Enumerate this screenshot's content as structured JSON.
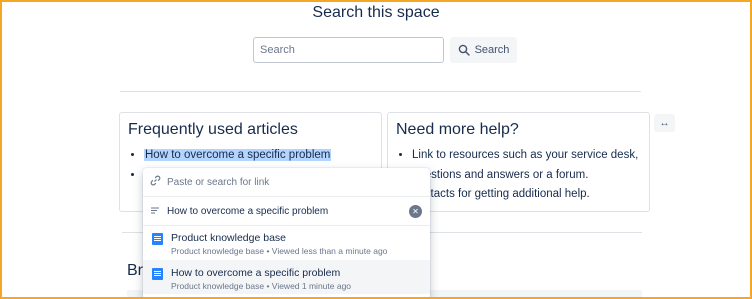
{
  "page": {
    "title": "Search this space"
  },
  "search": {
    "placeholder": "Search",
    "button_label": "Search"
  },
  "card_faq": {
    "heading": "Frequently used articles",
    "items": [
      "How to overcome a specific problem",
      ""
    ]
  },
  "card_help": {
    "heading": "Need more help?",
    "items": [
      "Link to resources such as your service desk, questions and answers or a forum.",
      "contacts for getting additional help."
    ]
  },
  "expand": {
    "label": "↔"
  },
  "bottom": {
    "heading_partial": "Bro"
  },
  "link_popup": {
    "url_placeholder": "Paste or search for link",
    "text_value": "How to overcome a specific problem",
    "results": [
      {
        "title": "Product knowledge base",
        "space": "Product knowledge base",
        "viewed": "Viewed less than a minute ago"
      },
      {
        "title": "How to overcome a specific problem",
        "space": "Product knowledge base",
        "viewed": "Viewed 1 minute ago"
      }
    ]
  },
  "colors": {
    "selection": "#b3d4ff",
    "doc_icon": "#2684ff",
    "frame": "#f5a623"
  }
}
